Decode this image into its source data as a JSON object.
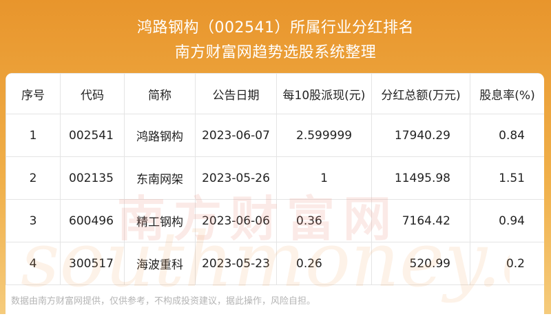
{
  "title": {
    "line1": "鸿路钢构（002541）所属行业分红排名",
    "line2": "南方财富网趋势选股系统整理"
  },
  "table": {
    "headers": [
      "序号",
      "代码",
      "简称",
      "公告日期",
      "每10股派现(元)",
      "分红总额(万元)",
      "股息率(%)"
    ],
    "rows": [
      [
        "1",
        "002541",
        "鸿路钢构",
        "2023-06-07",
        "2.599999",
        "17940.29",
        "0.84"
      ],
      [
        "2",
        "002135",
        "东南网架",
        "2023-05-26",
        "1",
        "11495.98",
        "1.51"
      ],
      [
        "3",
        "600496",
        "精工钢构",
        "2023-06-06",
        "0.36",
        "7164.42",
        "0.94"
      ],
      [
        "4",
        "300517",
        "海波重科",
        "2023-05-23",
        "0.26",
        "520.99",
        "0.2"
      ]
    ]
  },
  "footer": {
    "disclaimer": "数据由南方财富网提供，仅供参考，不构成投资建议，据此操作，风险自担。"
  },
  "watermark": {
    "cn": "南方财富网",
    "en": "southmoney.com"
  }
}
